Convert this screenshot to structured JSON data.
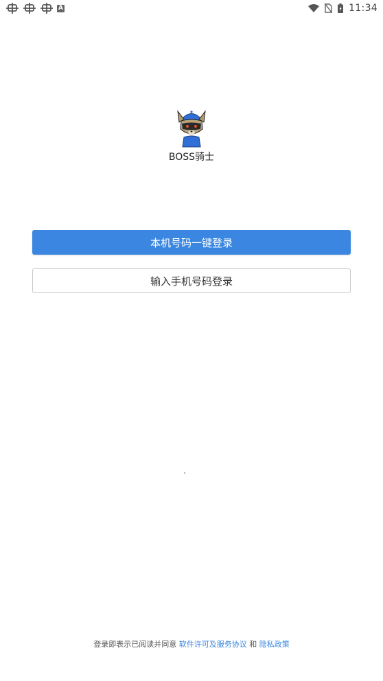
{
  "status_bar": {
    "time": "11:34",
    "notification_icons": [
      "bug-icon",
      "bug-icon",
      "bug-icon",
      "a-icon"
    ],
    "right_icons": [
      "wifi-icon",
      "no-sim-icon",
      "battery-icon"
    ]
  },
  "app": {
    "name": "BOSS骑士",
    "logo": "raccoon-mascot-logo"
  },
  "buttons": {
    "one_click_login": "本机号码一键登录",
    "phone_login": "输入手机号码登录"
  },
  "agreement": {
    "prefix": "登录即表示已阅读并同意",
    "license_link": "软件许可及服务协议",
    "and": "和",
    "privacy_link": "隐私政策"
  },
  "colors": {
    "primary": "#3a86e0",
    "background": "#ffffff"
  }
}
